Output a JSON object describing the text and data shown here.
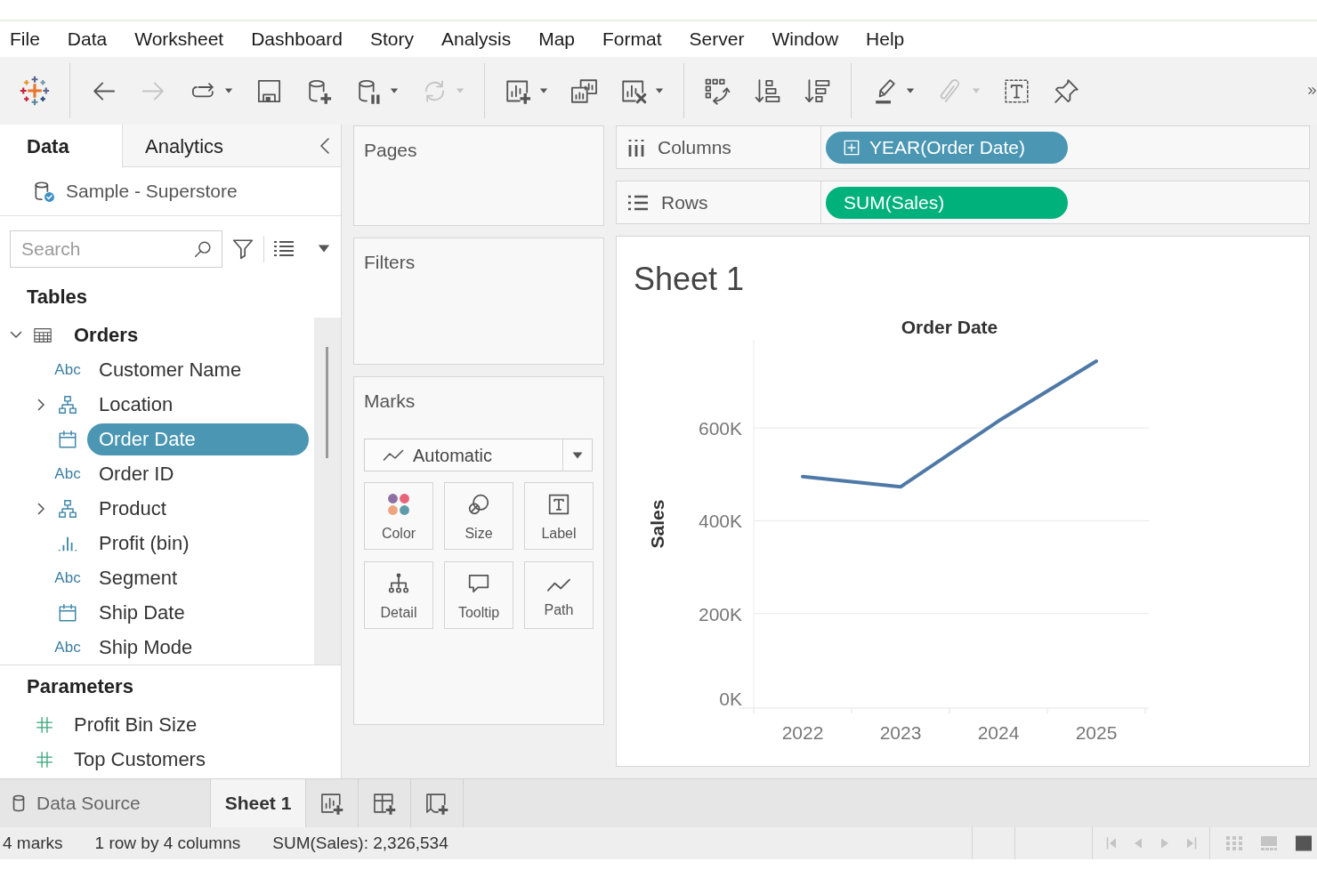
{
  "menu": [
    "File",
    "Data",
    "Worksheet",
    "Dashboard",
    "Story",
    "Analysis",
    "Map",
    "Format",
    "Server",
    "Window",
    "Help"
  ],
  "toolbar": [
    [
      {
        "kind": "back",
        "disabled": false,
        "menu": false
      },
      {
        "kind": "forward",
        "disabled": true,
        "menu": false
      },
      {
        "kind": "replay",
        "disabled": false,
        "menu": true
      },
      {
        "kind": "save",
        "disabled": false,
        "menu": false
      },
      {
        "kind": "new-data-source",
        "disabled": false,
        "menu": false
      },
      {
        "kind": "pause-updates",
        "disabled": false,
        "menu": true
      },
      {
        "kind": "refresh",
        "disabled": true,
        "menu": true
      }
    ],
    [
      {
        "kind": "new-worksheet",
        "disabled": false,
        "menu": true
      },
      {
        "kind": "duplicate",
        "disabled": false,
        "menu": false
      },
      {
        "kind": "clear",
        "disabled": false,
        "menu": true
      }
    ],
    [
      {
        "kind": "swap",
        "disabled": false,
        "menu": false
      },
      {
        "kind": "sort-ascending",
        "disabled": false,
        "menu": false
      },
      {
        "kind": "sort-descending",
        "disabled": false,
        "menu": false
      }
    ],
    [
      {
        "kind": "highlight",
        "disabled": false,
        "menu": true
      },
      {
        "kind": "attach",
        "disabled": true,
        "menu": true
      },
      {
        "kind": "text",
        "disabled": false,
        "menu": false
      },
      {
        "kind": "pin",
        "disabled": false,
        "menu": false
      }
    ]
  ],
  "data_pane": {
    "tabs": [
      {
        "label": "Data",
        "selected": true
      },
      {
        "label": "Analytics",
        "selected": false
      }
    ],
    "data_source": "Sample - Superstore",
    "search": {
      "placeholder": "Search"
    },
    "tables_heading": "Tables",
    "tables": [
      {
        "name": "Orders",
        "expanded": true,
        "children": [
          {
            "name": "Customer Name",
            "kind": "string",
            "type_label": "Abc",
            "selected": false
          },
          {
            "name": "Location",
            "kind": "hierarchy",
            "expanded": false,
            "selected": false
          },
          {
            "name": "Order Date",
            "kind": "date",
            "selected": true
          },
          {
            "name": "Order ID",
            "kind": "string",
            "type_label": "Abc",
            "selected": false
          },
          {
            "name": "Product",
            "kind": "hierarchy",
            "expanded": false,
            "selected": false
          },
          {
            "name": "Profit (bin)",
            "kind": "bin",
            "selected": false
          },
          {
            "name": "Segment",
            "kind": "string",
            "type_label": "Abc",
            "selected": false
          },
          {
            "name": "Ship Date",
            "kind": "date",
            "selected": false
          },
          {
            "name": "Ship Mode",
            "kind": "string",
            "type_label": "Abc",
            "selected": false
          }
        ]
      }
    ],
    "parameters_heading": "Parameters",
    "parameters": [
      {
        "name": "Profit Bin Size"
      },
      {
        "name": "Top Customers"
      }
    ]
  },
  "pages": {
    "title": "Pages"
  },
  "filters": {
    "title": "Filters"
  },
  "marks": {
    "title": "Marks",
    "mark_type": "Automatic",
    "properties": [
      {
        "label": "Color",
        "kind": "color"
      },
      {
        "label": "Size",
        "kind": "size"
      },
      {
        "label": "Label",
        "kind": "label"
      },
      {
        "label": "Detail",
        "kind": "detail"
      },
      {
        "label": "Tooltip",
        "kind": "tooltip"
      },
      {
        "label": "Path",
        "kind": "path"
      }
    ]
  },
  "shelves": [
    {
      "label": "Columns",
      "kind": "columns",
      "pills": [
        {
          "text": "YEAR(Order Date)",
          "kind": "discrete",
          "expandable": true
        }
      ]
    },
    {
      "label": "Rows",
      "kind": "rows",
      "pills": [
        {
          "text": "SUM(Sales)",
          "kind": "continuous",
          "expandable": false
        }
      ]
    }
  ],
  "view": {
    "title": "Sheet 1",
    "chart_data": {
      "type": "line",
      "xlabel": "Order Date",
      "ylabel": "Sales",
      "categories": [
        "2022",
        "2023",
        "2024",
        "2025"
      ],
      "values": [
        495000,
        473000,
        615000,
        744000
      ],
      "ylim": [
        0,
        790000
      ],
      "yticks": [
        {
          "value": 0,
          "label": "0K"
        },
        {
          "value": 200000,
          "label": "200K"
        },
        {
          "value": 400000,
          "label": "400K"
        },
        {
          "value": 600000,
          "label": "600K"
        }
      ],
      "grid": true
    }
  },
  "sheet_tabs": [
    {
      "label": "Data Source",
      "kind": "data-source",
      "selected": false
    },
    {
      "label": "Sheet 1",
      "kind": "sheet",
      "selected": true
    }
  ],
  "status_bar": [
    "4 marks",
    "1 row by 4 columns",
    "SUM(Sales): 2,326,534"
  ]
}
